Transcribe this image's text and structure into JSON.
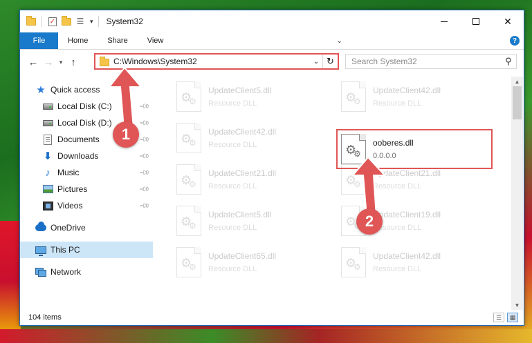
{
  "window": {
    "title": "System32",
    "controls": {
      "minimize": "",
      "maximize": "",
      "close": "✕"
    }
  },
  "ribbon": {
    "tabs": [
      {
        "label": "File",
        "active": true
      },
      {
        "label": "Home"
      },
      {
        "label": "Share"
      },
      {
        "label": "View"
      }
    ],
    "help": "?"
  },
  "address": {
    "path": "C:\\Windows\\System32",
    "search_placeholder": "Search System32"
  },
  "nav_pane": {
    "items": [
      {
        "label": "Quick access",
        "icon": "star-icon",
        "pinned": false
      },
      {
        "label": "Local Disk (C:)",
        "icon": "disk-icon",
        "pinned": true
      },
      {
        "label": "Local Disk (D:)",
        "icon": "disk-icon",
        "pinned": true
      },
      {
        "label": "Documents",
        "icon": "documents-icon",
        "pinned": true
      },
      {
        "label": "Downloads",
        "icon": "downloads-icon",
        "pinned": true
      },
      {
        "label": "Music",
        "icon": "music-icon",
        "pinned": true
      },
      {
        "label": "Pictures",
        "icon": "pictures-icon",
        "pinned": true
      },
      {
        "label": "Videos",
        "icon": "videos-icon",
        "pinned": true
      },
      {
        "label": "OneDrive",
        "icon": "onedrive-icon",
        "pinned": false
      },
      {
        "label": "This PC",
        "icon": "this-pc-icon",
        "pinned": false,
        "selected": true
      },
      {
        "label": "Network",
        "icon": "network-icon",
        "pinned": false
      }
    ]
  },
  "files": {
    "left_column": [
      {
        "name": "UpdateClient5.dll",
        "type": "Resource DLL"
      },
      {
        "name": "UpdateClient42.dll",
        "type": "Resource DLL"
      },
      {
        "name": "UpdateClient21.dll",
        "type": "Resource DLL"
      },
      {
        "name": "UpdateClient5.dll",
        "type": "Resource DLL"
      },
      {
        "name": "UpdateClient65.dll",
        "type": "Resource DLL"
      }
    ],
    "right_column": [
      {
        "name": "UpdateClient42.dll",
        "type": "Resource DLL"
      },
      {
        "name": "ooberes.dll",
        "type": "0.0.0.0",
        "highlighted": true
      },
      {
        "name": "UpdateClient21.dll",
        "type": "Resource DLL"
      },
      {
        "name": "UpdateClient19.dll",
        "type": "Resource DLL"
      },
      {
        "name": "UpdateClient42.dll",
        "type": "Resource DLL"
      }
    ]
  },
  "status": {
    "item_count": "104 items"
  },
  "annotations": {
    "step1": "1",
    "step2": "2",
    "color": "#e05656"
  }
}
